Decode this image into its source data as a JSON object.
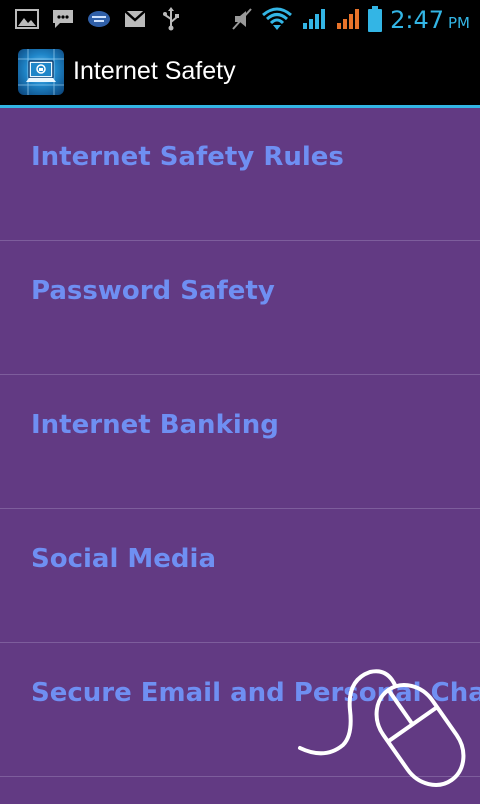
{
  "status_bar": {
    "icons_left": [
      "gallery-icon",
      "message-icon",
      "app-notification-icon",
      "gmail-icon",
      "usb-icon"
    ],
    "icons_right": [
      "mute-icon",
      "wifi-icon",
      "signal-icon",
      "signal-roaming-icon",
      "battery-icon"
    ],
    "time": "2:47",
    "ampm": "PM",
    "accent": "#33b5e5"
  },
  "action_bar": {
    "title": "Internet Safety",
    "logo_icon": "internet-safety-app-icon"
  },
  "list": {
    "items": [
      {
        "label": "Internet Safety Rules"
      },
      {
        "label": "Password Safety"
      },
      {
        "label": "Internet Banking"
      },
      {
        "label": "Social Media"
      },
      {
        "label": "Secure Email and Personal Chat"
      }
    ],
    "background": "#623a83",
    "label_color": "#6f8ff2",
    "divider_color": "#7d5d9c"
  },
  "overlay": {
    "icon": "mouse-cursor-icon"
  }
}
